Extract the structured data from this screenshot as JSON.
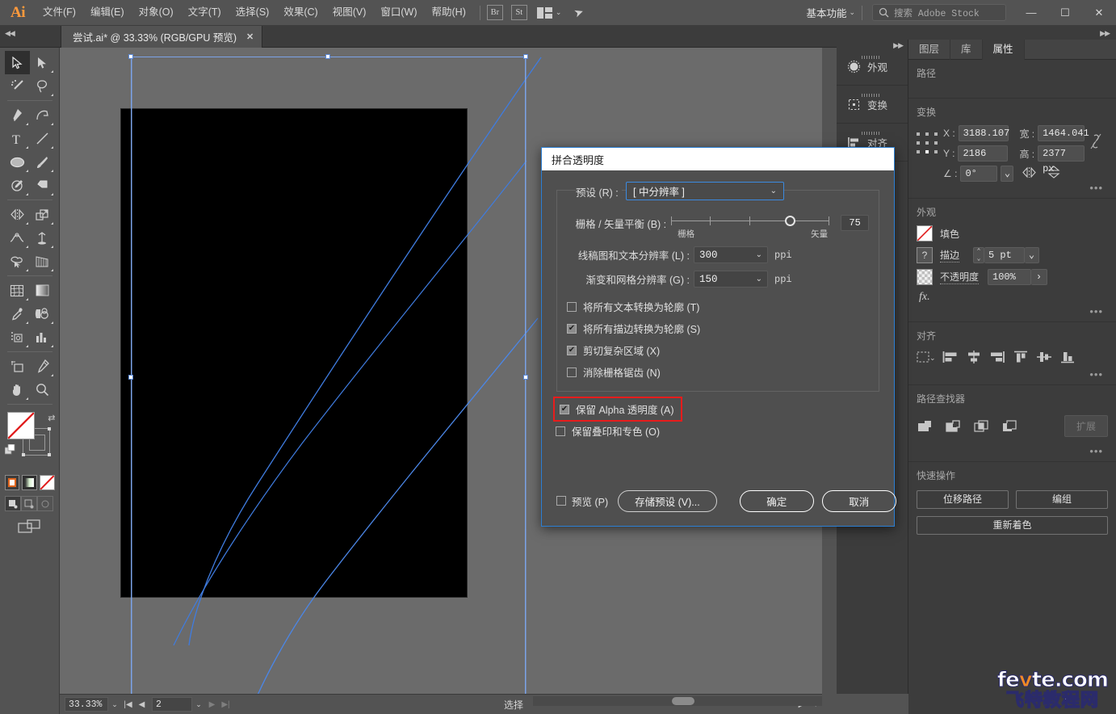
{
  "app": {
    "logo": "Ai",
    "menus": [
      {
        "label": "文件(F)"
      },
      {
        "label": "编辑(E)"
      },
      {
        "label": "对象(O)"
      },
      {
        "label": "文字(T)"
      },
      {
        "label": "选择(S)"
      },
      {
        "label": "效果(C)"
      },
      {
        "label": "视图(V)"
      },
      {
        "label": "窗口(W)"
      },
      {
        "label": "帮助(H)"
      }
    ],
    "bridge_button": "Br",
    "stock_button": "St",
    "workspace": "基本功能",
    "search_placeholder": "搜索 Adobe Stock",
    "window_minimize": "—",
    "window_maximize": "☐",
    "window_close": "✕"
  },
  "document_tab": {
    "title": "尝试.ai* @ 33.33% (RGB/GPU 预览)",
    "close": "✕"
  },
  "toolbar": {
    "tools": [
      {
        "name": "selection-tool",
        "active": true
      },
      {
        "name": "direct-selection-tool",
        "active": false
      },
      {
        "name": "magic-wand-tool",
        "active": false
      },
      {
        "name": "lasso-tool",
        "active": false
      },
      {
        "name": "pen-tool",
        "active": false
      },
      {
        "name": "curvature-tool",
        "active": false
      },
      {
        "name": "type-tool",
        "active": false
      },
      {
        "name": "line-segment-tool",
        "active": false
      },
      {
        "name": "ellipse-tool",
        "active": false
      },
      {
        "name": "paintbrush-tool",
        "active": false
      },
      {
        "name": "shaper-tool",
        "active": false
      },
      {
        "name": "eraser-tool",
        "active": false
      },
      {
        "name": "reflect-tool",
        "active": false
      },
      {
        "name": "scale-tool",
        "active": false
      },
      {
        "name": "width-tool",
        "active": false
      },
      {
        "name": "free-transform-tool",
        "active": false
      },
      {
        "name": "shape-builder-tool",
        "active": false
      },
      {
        "name": "perspective-grid-tool",
        "active": false
      },
      {
        "name": "mesh-tool",
        "active": false
      },
      {
        "name": "gradient-tool",
        "active": false
      },
      {
        "name": "eyedropper-tool",
        "active": false
      },
      {
        "name": "blend-tool",
        "active": false
      },
      {
        "name": "symbol-sprayer-tool",
        "active": false
      },
      {
        "name": "column-graph-tool",
        "active": false
      },
      {
        "name": "artboard-tool",
        "active": false
      },
      {
        "name": "slice-tool",
        "active": false
      },
      {
        "name": "hand-tool",
        "active": false
      },
      {
        "name": "zoom-tool",
        "active": false
      }
    ],
    "fill_color": "#ffffff",
    "fill_is_none": true,
    "stroke_is_none": true,
    "color_modes": [
      "color-swatch",
      "gradient-swatch",
      "none-swatch"
    ],
    "draw_modes": [
      "draw-normal",
      "draw-behind",
      "draw-inside"
    ],
    "screen_mode": "change-screen-mode"
  },
  "canvas": {
    "artboard_fill": "#000000",
    "selection_color": "#7ba3e8",
    "path_stroke_color": "#3f7ce0"
  },
  "rail": {
    "items": [
      {
        "label": "外观",
        "icon": "appearance-icon"
      },
      {
        "label": "变换",
        "icon": "transform-icon"
      },
      {
        "label": "对齐",
        "icon": "align-icon"
      }
    ]
  },
  "properties": {
    "tabs": [
      {
        "label": "图层",
        "active": false
      },
      {
        "label": "库",
        "active": false
      },
      {
        "label": "属性",
        "active": true
      }
    ],
    "path_section": {
      "title": "路径"
    },
    "transform": {
      "title": "变换",
      "x_label": "X :",
      "x_value": "3188.107",
      "y_label": "Y :",
      "y_value": "2186 px",
      "w_label": "宽 :",
      "w_value": "1464.041",
      "h_label": "高 :",
      "h_value": "2377 px",
      "angle_label": "∠ :",
      "angle_value": "0°",
      "more": "•••"
    },
    "appearance": {
      "title": "外观",
      "fill_label": "填色",
      "stroke_label": "描边",
      "stroke_weight": "5 pt",
      "opacity_label": "不透明度",
      "opacity_value": "100%",
      "fx_label": "fx.",
      "more": "•••"
    },
    "align": {
      "title": "对齐",
      "more": "•••",
      "buttons": [
        "align-to-selection",
        "align-left",
        "align-horizontal-center",
        "align-right",
        "align-top",
        "align-vertical-center",
        "align-bottom"
      ]
    },
    "pathfinder": {
      "title": "路径查找器",
      "expand_label": "扩展",
      "more": "•••",
      "buttons": [
        "unite",
        "minus-front",
        "intersect",
        "exclude"
      ]
    },
    "quick_actions": {
      "title": "快速操作",
      "buttons": [
        {
          "label": "位移路径"
        },
        {
          "label": "编组"
        },
        {
          "label": "重新着色",
          "wide": true
        }
      ]
    }
  },
  "statusbar": {
    "zoom": "33.33%",
    "page": "2",
    "status_text": "选择",
    "first_page_icon": "first-page-icon",
    "prev_page_icon": "prev-page-icon",
    "next_page_icon": "next-page-icon",
    "last_page_icon": "last-page-icon"
  },
  "dialog": {
    "title": "拼合透明度",
    "preset_label": "预设 (R) :",
    "preset_value": "[ 中分辨率 ]",
    "balance": {
      "label": "栅格 / 矢量平衡 (B) :",
      "value": "75",
      "min_label": "栅格",
      "max_label": "矢量",
      "percent": 75
    },
    "line_art_resolution": {
      "label": "线稿图和文本分辨率 (L) :",
      "value": "300",
      "unit": "ppi"
    },
    "gradient_resolution": {
      "label": "渐变和网格分辨率 (G) :",
      "value": "150",
      "unit": "ppi"
    },
    "checkboxes": [
      {
        "label": "将所有文本转换为轮廓 (T)",
        "checked": false
      },
      {
        "label": "将所有描边转换为轮廓 (S)",
        "checked": true
      },
      {
        "label": "剪切复杂区域 (X)",
        "checked": true
      },
      {
        "label": "消除栅格锯齿 (N)",
        "checked": false
      }
    ],
    "alpha_checkbox": {
      "label": "保留 Alpha 透明度 (A)",
      "checked": true,
      "highlighted": true
    },
    "overprint_checkbox": {
      "label": "保留叠印和专色 (O)",
      "checked": false
    },
    "preview_checkbox": {
      "label": "预览 (P)",
      "checked": false
    },
    "save_preset_button": "存储预设 (V)...",
    "ok_button": "确定",
    "cancel_button": "取消",
    "highlight_color": "#e81c1c",
    "check_glyph": "✔"
  },
  "watermark": {
    "line1_a": "fe",
    "line1_b": "v",
    "line1_c": "te.com",
    "line2": "飞特教程网"
  }
}
